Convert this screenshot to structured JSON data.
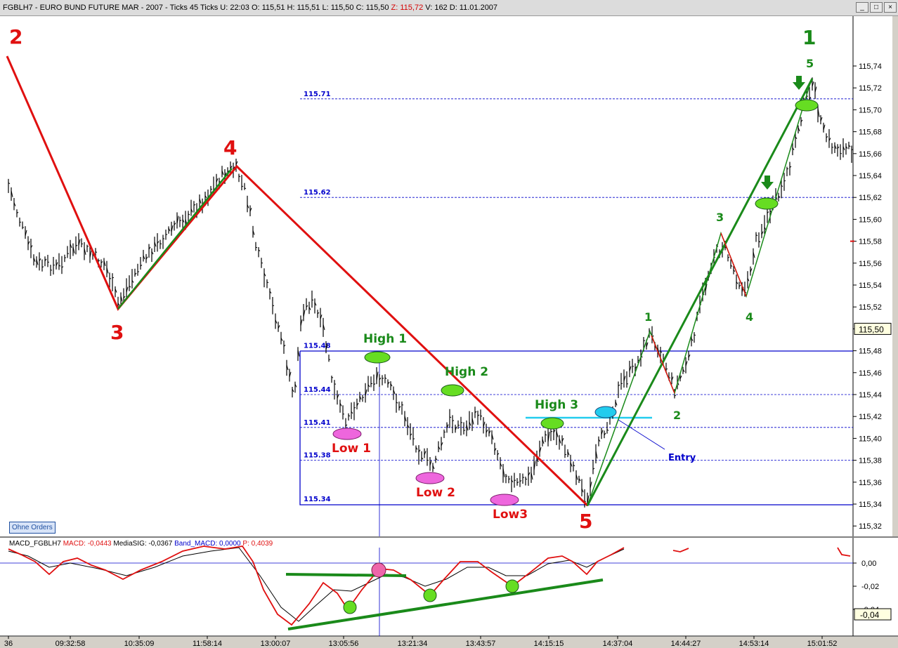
{
  "title": {
    "symbol": "FGBLH7",
    "sep": " - ",
    "instrument": "EURO BUND FUTURE  MAR - 2007",
    "ticks": " - Ticks 45 Ticks ",
    "u": "U: 22:03",
    "o": "O: 115,51",
    "h": "H: 115,51",
    "l": "L: 115,50",
    "c": "C: 115,50",
    "z": "Z: 115,72",
    "v": "V: 162",
    "d": "D: 11.01.2007"
  },
  "window_buttons": [
    "_",
    "□",
    "×"
  ],
  "colors": {
    "wave": "#e01010",
    "green": "#1a8a1a",
    "blue": "#0000cc",
    "light_green": "#66dd22",
    "pink": "#ee66dd",
    "cyan": "#22ccee",
    "bar": "#000000"
  },
  "price_axis": {
    "ticks": [
      "115,74",
      "115,72",
      "115,70",
      "115,68",
      "115,66",
      "115,64",
      "115,62",
      "115,60",
      "115,58",
      "115,56",
      "115,54",
      "115,52",
      "115,50",
      "115,48",
      "115,46",
      "115,44",
      "115,42",
      "115,40",
      "115,38",
      "115,36",
      "115,34",
      "115,32"
    ],
    "current": "115,50"
  },
  "macd_axis": {
    "ticks": [
      "0,00",
      "-0,02",
      "-0,04"
    ],
    "partial": "-0,04",
    "current": "-0,04"
  },
  "time_axis": [
    "36",
    "09:32:58",
    "10:35:09",
    "11:58:14",
    "13:00:07",
    "13:05:56",
    "13:21:34",
    "13:43:57",
    "14:15:15",
    "14:37:04",
    "14:44:27",
    "14:53:14",
    "15:01:52"
  ],
  "levels": [
    "115.71",
    "115.62",
    "115.48",
    "115.44",
    "115.41",
    "115.38",
    "115.34"
  ],
  "wave_labels": {
    "red_2": "2",
    "red_3": "3",
    "red_4": "4",
    "red_5": "5",
    "green_1_big": "1",
    "green_5": "5",
    "green_3": "3",
    "green_4": "4",
    "green_1": "1",
    "green_2": "2"
  },
  "pattern_labels": {
    "high1": "High 1",
    "high2": "High 2",
    "high3": "High 3",
    "low1": "Low 1",
    "low2": "Low 2",
    "low3": "Low3",
    "entry": "Entry"
  },
  "macd_legend": {
    "name": "MACD_FGBLH7",
    "macd": "MACD: -0,0443",
    "sig": "MediaSIG: -0,0367",
    "band": "Band_MACD: 0,0000",
    "p": "P: 0,4039"
  },
  "orders_button": "Ohne Orders"
}
